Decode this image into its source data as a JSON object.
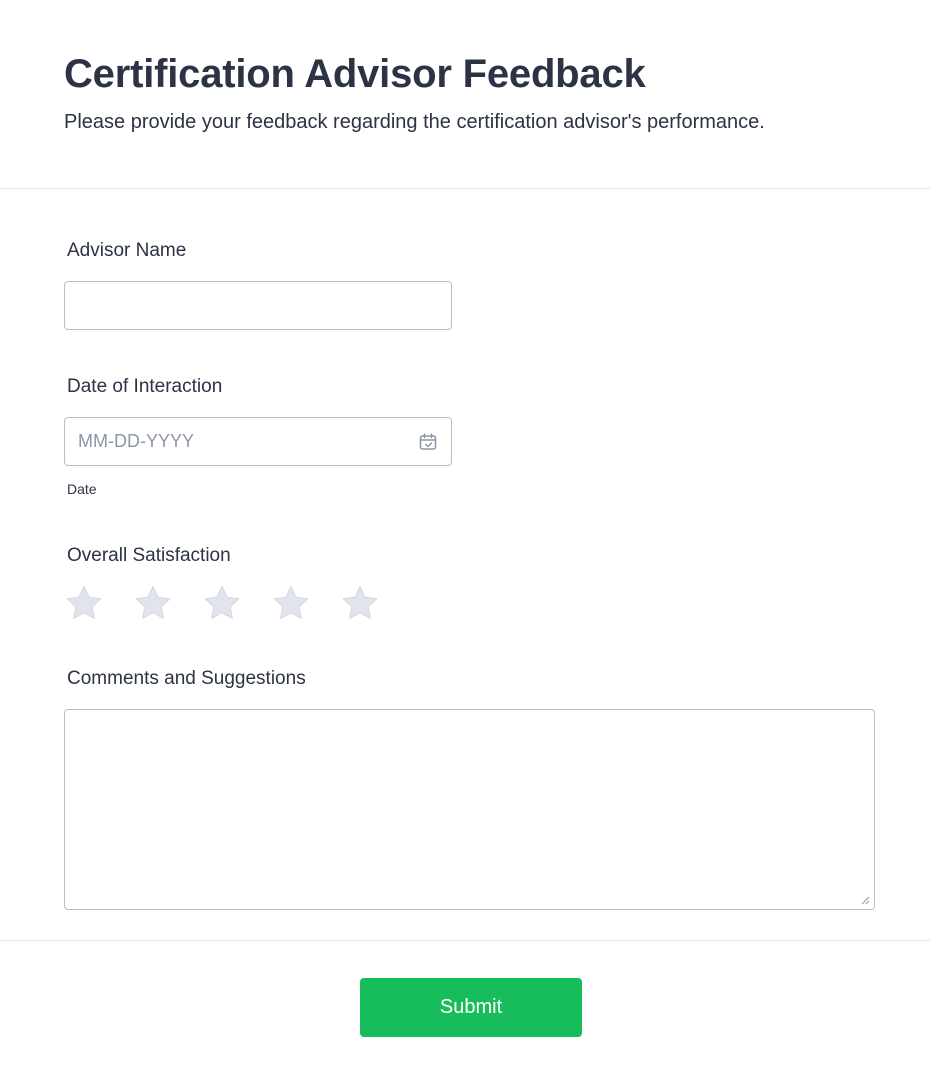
{
  "header": {
    "title": "Certification Advisor Feedback",
    "subtitle": "Please provide your feedback regarding the certification advisor's performance."
  },
  "fields": {
    "advisor_name": {
      "label": "Advisor Name",
      "value": ""
    },
    "date": {
      "label": "Date of Interaction",
      "placeholder": "MM-DD-YYYY",
      "sublabel": "Date",
      "icon": "calendar-icon"
    },
    "satisfaction": {
      "label": "Overall Satisfaction",
      "max_rating": 5,
      "rating": 0,
      "icon": "star-icon"
    },
    "comments": {
      "label": "Comments and Suggestions",
      "value": ""
    }
  },
  "submit": {
    "label": "Submit"
  },
  "colors": {
    "text": "#2c3345",
    "placeholder": "#8d95a8",
    "border": "#b8bdc9",
    "divider": "#e3e5eb",
    "star_empty": "#e1e4ec",
    "accent": "#18bd5b"
  }
}
